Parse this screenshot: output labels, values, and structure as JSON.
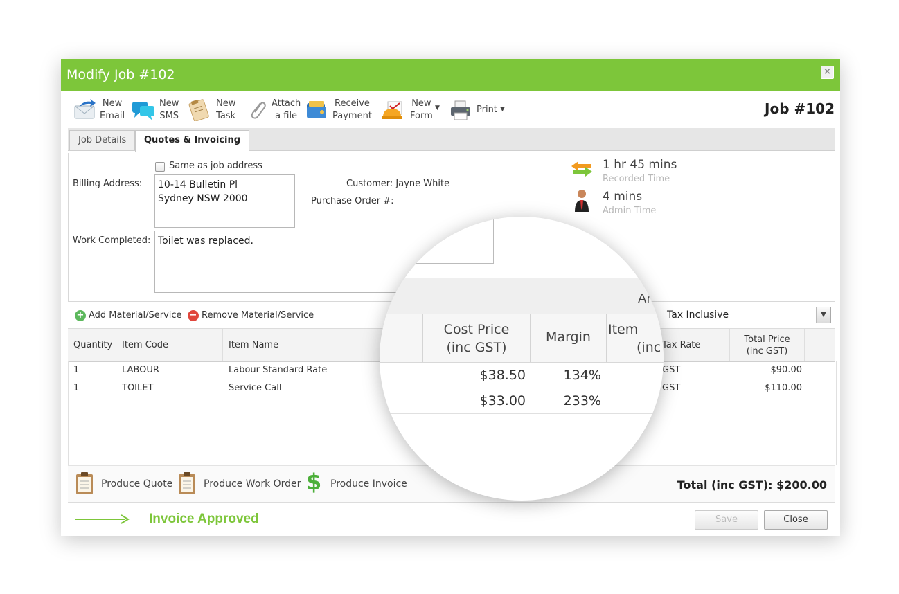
{
  "window": {
    "title": "Modify Job #102",
    "job_number": "Job #102"
  },
  "toolbar": [
    {
      "line1": "New",
      "line2": "Email",
      "icon": "email-icon"
    },
    {
      "line1": "New",
      "line2": "SMS",
      "icon": "sms-icon"
    },
    {
      "line1": "New",
      "line2": "Task",
      "icon": "task-icon"
    },
    {
      "line1": "Attach",
      "line2": "a file",
      "icon": "paperclip-icon"
    },
    {
      "line1": "Receive",
      "line2": "Payment",
      "icon": "wallet-icon"
    },
    {
      "line1": "New",
      "line2": "Form",
      "icon": "form-icon"
    },
    {
      "line1": "Print",
      "line2": "",
      "icon": "printer-icon"
    }
  ],
  "tabs": [
    {
      "label": "Job Details"
    },
    {
      "label": "Quotes & Invoicing"
    }
  ],
  "billing": {
    "same_as_job": "Same as job address",
    "label": "Billing Address:",
    "address_line1": "10-14 Bulletin Pl",
    "address_line2": "Sydney NSW 2000",
    "customer": "Customer: Jayne White",
    "po_label": "Purchase Order #:"
  },
  "work": {
    "label": "Work Completed:",
    "value": "Toilet was replaced."
  },
  "time": {
    "recorded_value": "1 hr 45 mins",
    "recorded_label": "Recorded Time",
    "admin_value": "4 mins",
    "admin_label": "Admin Time"
  },
  "materials": {
    "add": "Add Material/Service",
    "remove": "Remove Material/Service",
    "tax_mode": "Tax Inclusive"
  },
  "grid": {
    "headers": {
      "quantity": "Quantity",
      "item_code": "Item Code",
      "item_name": "Item Name",
      "tax_rate": "Tax Rate",
      "total_price_1": "Total Price",
      "total_price_2": "(inc GST)"
    },
    "rows": [
      {
        "quantity": "1",
        "item_code": "LABOUR",
        "item_name": "Labour Standard Rate",
        "tax_rate": "GST",
        "total": "$90.00"
      },
      {
        "quantity": "1",
        "item_code": "TOILET",
        "item_name": "Service Call",
        "tax_rate": "GST",
        "total": "$110.00"
      }
    ]
  },
  "magnifier": {
    "header_cut": "Ar",
    "cost_price_1": "Cost Price",
    "cost_price_2": "(inc GST)",
    "margin": "Margin",
    "item_1": "Item",
    "item_2": "(inc",
    "rows": [
      {
        "cost": "$38.50",
        "margin": "134%"
      },
      {
        "cost": "$33.00",
        "margin": "233%"
      }
    ]
  },
  "footer": {
    "produce_quote": "Produce Quote",
    "produce_work_order": "Produce Work Order",
    "produce_invoice": "Produce Invoice",
    "total": "Total (inc GST): $200.00"
  },
  "buttons": {
    "save": "Save",
    "close": "Close"
  },
  "annotation": {
    "text": "Invoice Approved",
    "color": "#7dc63a"
  }
}
